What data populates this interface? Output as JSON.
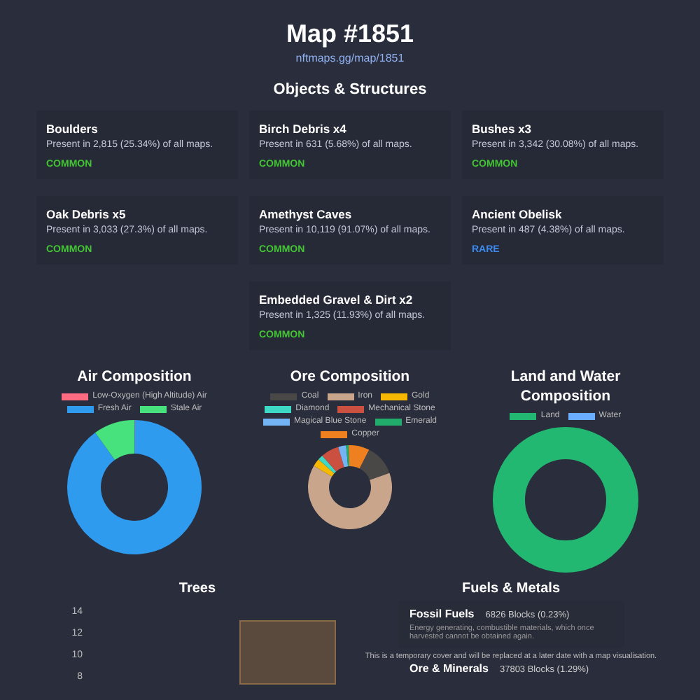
{
  "title": "Map #1851",
  "url": "nftmaps.gg/map/1851",
  "objects": {
    "heading": "Objects & Structures",
    "items": [
      {
        "name": "Boulders",
        "presence": "Present in 2,815 (25.34%) of all maps.",
        "rarity": "COMMON",
        "kind": "common"
      },
      {
        "name": "Birch Debris x4",
        "presence": "Present in 631 (5.68%) of all maps.",
        "rarity": "COMMON",
        "kind": "common"
      },
      {
        "name": "Bushes x3",
        "presence": "Present in 3,342 (30.08%) of all maps.",
        "rarity": "COMMON",
        "kind": "common"
      },
      {
        "name": "Oak Debris x5",
        "presence": "Present in 3,033 (27.3%) of all maps.",
        "rarity": "COMMON",
        "kind": "common"
      },
      {
        "name": "Amethyst Caves",
        "presence": "Present in 10,119 (91.07%) of all maps.",
        "rarity": "COMMON",
        "kind": "common"
      },
      {
        "name": "Ancient Obelisk",
        "presence": "Present in 487 (4.38%) of all maps.",
        "rarity": "RARE",
        "kind": "rare"
      },
      {
        "name": "Embedded Gravel & Dirt x2",
        "presence": "Present in 1,325 (11.93%) of all maps.",
        "rarity": "COMMON",
        "kind": "common"
      }
    ]
  },
  "compositions": [
    {
      "title": "Air Composition",
      "legend": [
        {
          "label": "Low-Oxygen (High Altitude) Air",
          "color": "#ff6b81"
        },
        {
          "label": "Fresh Air",
          "color": "#2f9bef"
        },
        {
          "label": "Stale Air",
          "color": "#47e27d"
        }
      ]
    },
    {
      "title": "Ore Composition",
      "legend": [
        {
          "label": "Coal",
          "color": "#4a4747"
        },
        {
          "label": "Iron",
          "color": "#c9a58c"
        },
        {
          "label": "Gold",
          "color": "#f6b800"
        },
        {
          "label": "Diamond",
          "color": "#3fd8c4"
        },
        {
          "label": "Mechanical Stone",
          "color": "#cc5040"
        },
        {
          "label": "Magical Blue Stone",
          "color": "#74b4f5"
        },
        {
          "label": "Emerald",
          "color": "#22ac6c"
        },
        {
          "label": "Copper",
          "color": "#ee8020"
        }
      ]
    },
    {
      "title": "Land and Water Composition",
      "legend": [
        {
          "label": "Land",
          "color": "#22b872"
        },
        {
          "label": "Water",
          "color": "#6aafff"
        }
      ]
    }
  ],
  "trees": {
    "title": "Trees",
    "axis_labels": [
      "14",
      "12",
      "10",
      "8"
    ]
  },
  "fuels": {
    "title": "Fuels & Metals",
    "items": [
      {
        "name": "Fossil Fuels",
        "amount": "6826 Blocks (0.23%)",
        "description": "Energy generating, combustible materials, which once harvested cannot be obtained again."
      },
      {
        "name": "Ore & Minerals",
        "amount": "37803 Blocks (1.29%)"
      }
    ],
    "notice": "This is a temporary cover and will be replaced at a later date with a map visualisation."
  }
}
